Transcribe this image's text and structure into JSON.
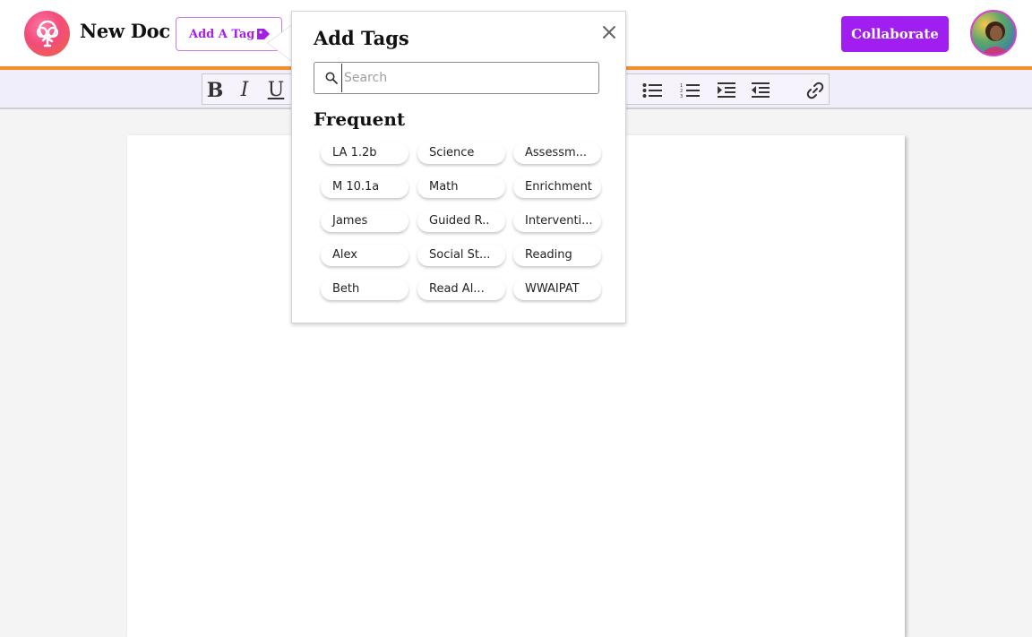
{
  "header": {
    "app_title": "New Doc",
    "add_tag_label": "Add A Tag",
    "collaborate_label": "Collaborate",
    "accent_color": "#a01ef0",
    "divider_color": "#f68c2a"
  },
  "toolbar": {
    "bold": "B",
    "italic": "I",
    "underline": "U",
    "icons": [
      "bullet-list-icon",
      "numbered-list-icon",
      "indent-icon",
      "outdent-icon",
      "link-icon"
    ]
  },
  "popover": {
    "title": "Add Tags",
    "search_placeholder": "Search",
    "section_title": "Frequent",
    "tags": [
      "LA 1.2b",
      "Science",
      "Assessm...",
      "M 10.1a",
      "Math",
      "Enrichment",
      "James",
      "Guided R..",
      "Interventi...",
      "Alex",
      "Social St...",
      "Reading",
      "Beth",
      "Read Al...",
      "WWAIPAT"
    ]
  }
}
